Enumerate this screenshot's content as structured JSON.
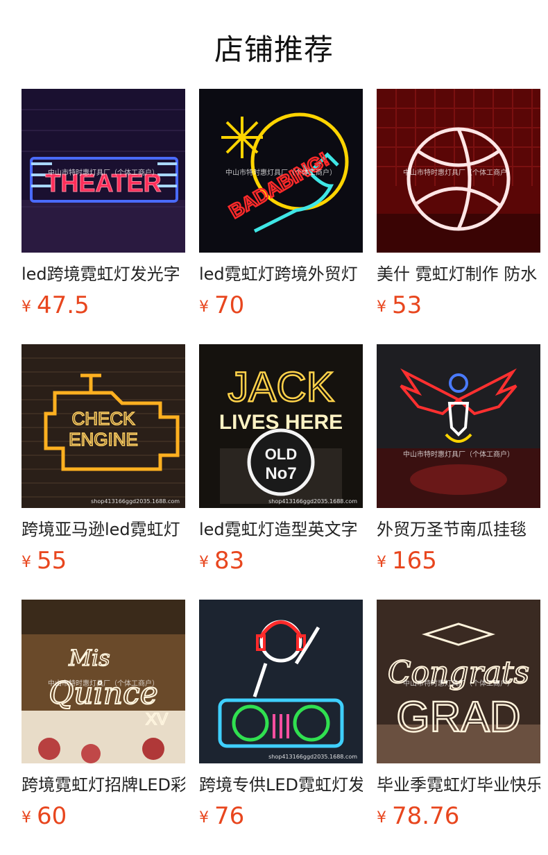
{
  "page_title": "店铺推荐",
  "currency_symbol": "¥",
  "products": [
    {
      "name": "led跨境霓虹灯发光字",
      "price": "47.5",
      "image_text": "THEATER",
      "watermark": "中山市特时惠灯具厂（个体工商户）"
    },
    {
      "name": "led霓虹灯跨境外贸灯",
      "price": "70",
      "image_text": "BADABING!",
      "watermark": "中山市特时惠灯具厂（个体工商户）"
    },
    {
      "name": "美什 霓虹灯制作 防水",
      "price": "53",
      "image_text": "",
      "watermark": "中山市特时惠灯具厂（个体工商户）"
    },
    {
      "name": "跨境亚马逊led霓虹灯",
      "price": "55",
      "image_text": "CHECK ENGINE",
      "watermark": "shop413166ggd2035.1688.com"
    },
    {
      "name": "led霓虹灯造型英文字",
      "price": "83",
      "image_text": "JACK LIVES HERE OLD No7",
      "watermark": "shop413166ggd2035.1688.com"
    },
    {
      "name": "外贸万圣节南瓜挂毯",
      "price": "165",
      "image_text": "",
      "watermark": "中山市特时惠灯具厂（个体工商户）"
    },
    {
      "name": "跨境霓虹灯招牌LED彩",
      "price": "60",
      "image_text": "Mis Quince XV",
      "watermark": "中山市特时惠灯具厂（个体工商户）"
    },
    {
      "name": "跨境专供LED霓虹灯发",
      "price": "76",
      "image_text": "",
      "watermark": "shop413166ggd2035.1688.com"
    },
    {
      "name": "毕业季霓虹灯毕业快乐",
      "price": "78.76",
      "image_text": "Congrats GRAD",
      "watermark": "中山市特时惠灯具厂（个体工商户）"
    }
  ]
}
